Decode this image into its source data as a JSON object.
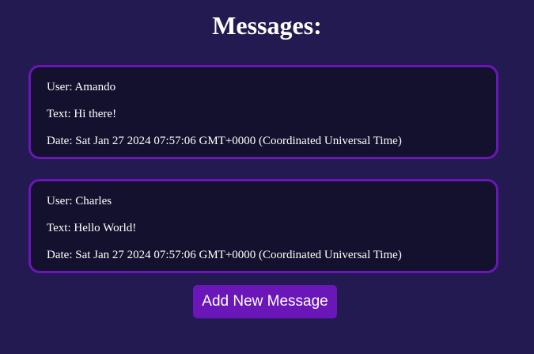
{
  "page": {
    "title": "Messages:"
  },
  "messages": [
    {
      "user_label": "User: Amando",
      "text_label": "Text: Hi there!",
      "date_label": "Date: Sat Jan 27 2024 07:57:06 GMT+0000 (Coordinated Universal Time)"
    },
    {
      "user_label": "User: Charles",
      "text_label": "Text: Hello World!",
      "date_label": "Date: Sat Jan 27 2024 07:57:06 GMT+0000 (Coordinated Universal Time)"
    }
  ],
  "actions": {
    "add_label": "Add New Message"
  },
  "colors": {
    "background": "#221a50",
    "card_background": "#13112d",
    "accent": "#6a16b8",
    "text": "#ffffff"
  }
}
